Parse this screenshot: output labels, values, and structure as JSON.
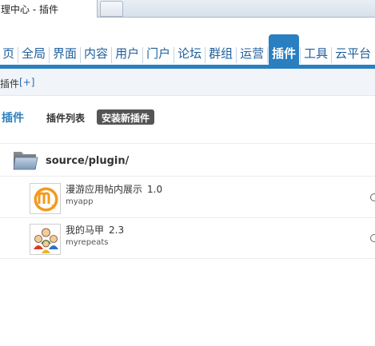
{
  "browser": {
    "tab_title": "理中心 - 插件"
  },
  "nav": {
    "items": [
      {
        "label": "页"
      },
      {
        "label": "全局"
      },
      {
        "label": "界面"
      },
      {
        "label": "内容"
      },
      {
        "label": "用户"
      },
      {
        "label": "门户"
      },
      {
        "label": "论坛"
      },
      {
        "label": "群组"
      },
      {
        "label": "运营"
      },
      {
        "label": "插件",
        "active": true
      },
      {
        "label": "工具"
      },
      {
        "label": "云平台"
      }
    ],
    "accent_color": "#2a7fc0"
  },
  "subnav": {
    "label": "插件",
    "add_label": "[+]"
  },
  "page": {
    "title": "插件",
    "tab_list": "插件列表",
    "tab_install": "安装新插件"
  },
  "folder": {
    "icon": "folder-icon",
    "path": "source/plugin/"
  },
  "plugins": [
    {
      "name": "漫游应用帖内展示",
      "version": "1.0",
      "id": "myapp",
      "icon": "myapp-logo-icon"
    },
    {
      "name": "我的马甲",
      "version": "2.3",
      "id": "myrepeats",
      "icon": "people-group-icon"
    }
  ]
}
